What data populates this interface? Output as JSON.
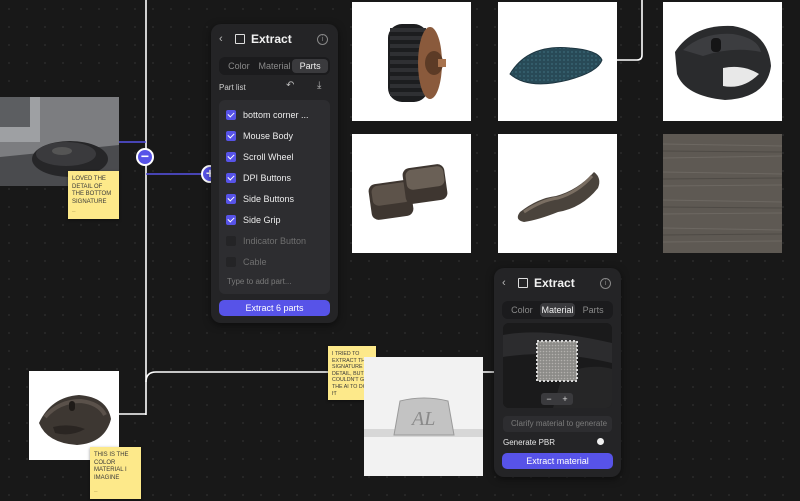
{
  "part_panel": {
    "title": "Extract",
    "tabs": [
      "Color",
      "Material",
      "Parts"
    ],
    "active_tab": "Parts",
    "list_label": "Part list",
    "parts": [
      {
        "label": "bottom corner ...",
        "checked": true
      },
      {
        "label": "Mouse Body",
        "checked": true
      },
      {
        "label": "Scroll Wheel",
        "checked": true
      },
      {
        "label": "DPI Buttons",
        "checked": true
      },
      {
        "label": "Side Buttons",
        "checked": true
      },
      {
        "label": "Side Grip",
        "checked": true
      },
      {
        "label": "Indicator Button",
        "checked": false
      },
      {
        "label": "Cable",
        "checked": false
      }
    ],
    "add_placeholder": "Type to add part...",
    "extract_button": "Extract 6 parts"
  },
  "material_panel": {
    "title": "Extract",
    "tabs": [
      "Color",
      "Material",
      "Parts"
    ],
    "active_tab": "Material",
    "zoom_minus": "−",
    "zoom_plus": "+",
    "clarify_placeholder": "Clarify material to generate",
    "generate_pbr_label": "Generate PBR",
    "generate_pbr_on": false,
    "extract_button": "Extract material"
  },
  "notes": {
    "note1": {
      "text": "Loved the detail of the bottom signature"
    },
    "note2": {
      "text": "I tried to extract the signature detail, but I couldn't get the AI to do it"
    },
    "note3": {
      "text": "This is the color material I imagine"
    }
  },
  "nodes": {
    "minus": "−",
    "plus": "+"
  },
  "colors": {
    "accent": "#5753e8",
    "canvas": "#181818",
    "panel": "#242426",
    "note": "#fde98a"
  }
}
